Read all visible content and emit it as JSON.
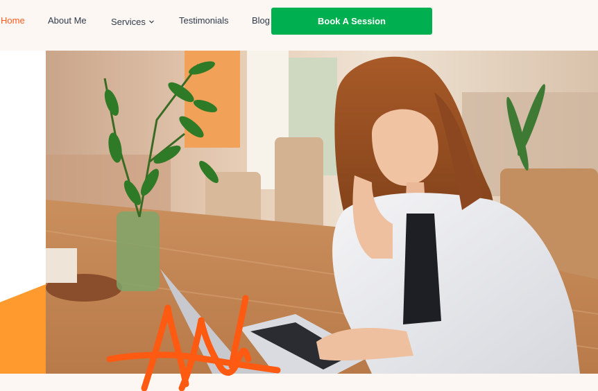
{
  "nav": {
    "items": [
      {
        "label": "Home",
        "active": true
      },
      {
        "label": "About Me",
        "active": false
      },
      {
        "label": "Services",
        "active": false,
        "has_dropdown": true
      },
      {
        "label": "Testimonials",
        "active": false
      },
      {
        "label": "Blog",
        "active": false
      }
    ],
    "cta_label": "Book A Session"
  },
  "colors": {
    "accent": "#ff5a1f",
    "cta": "#00b050",
    "orange_shape": "#ff9a2e",
    "signature": "#ff5a12",
    "background": "#fdf7f3"
  },
  "icons": {
    "services_dropdown": "chevron-down-icon"
  }
}
